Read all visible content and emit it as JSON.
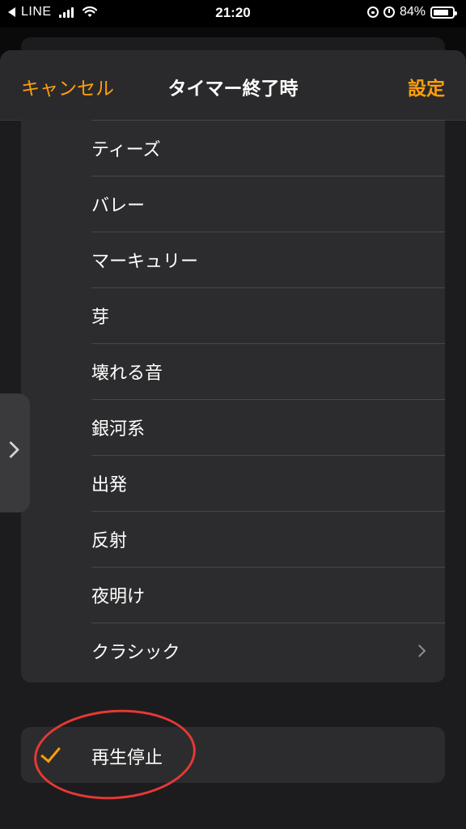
{
  "status_bar": {
    "carrier": "LINE",
    "time": "21:20",
    "battery_percent": "84%",
    "battery_level": 0.84,
    "icons": [
      "back-arrow-icon",
      "signal-icon",
      "wifi-icon",
      "orientation-lock-icon",
      "alarm-icon",
      "battery-icon"
    ]
  },
  "nav": {
    "cancel": "キャンセル",
    "title": "タイマー終了時",
    "set": "設定"
  },
  "sounds": [
    {
      "label": "ティーズ"
    },
    {
      "label": "バレー"
    },
    {
      "label": "マーキュリー"
    },
    {
      "label": "芽"
    },
    {
      "label": "壊れる音"
    },
    {
      "label": "銀河系"
    },
    {
      "label": "出発"
    },
    {
      "label": "反射"
    },
    {
      "label": "夜明け"
    },
    {
      "label": "クラシック",
      "chevron": true
    }
  ],
  "stop_option": {
    "label": "再生停止",
    "selected": true
  },
  "colors": {
    "accent": "#ff9f0a",
    "annotation": "#e53935"
  }
}
